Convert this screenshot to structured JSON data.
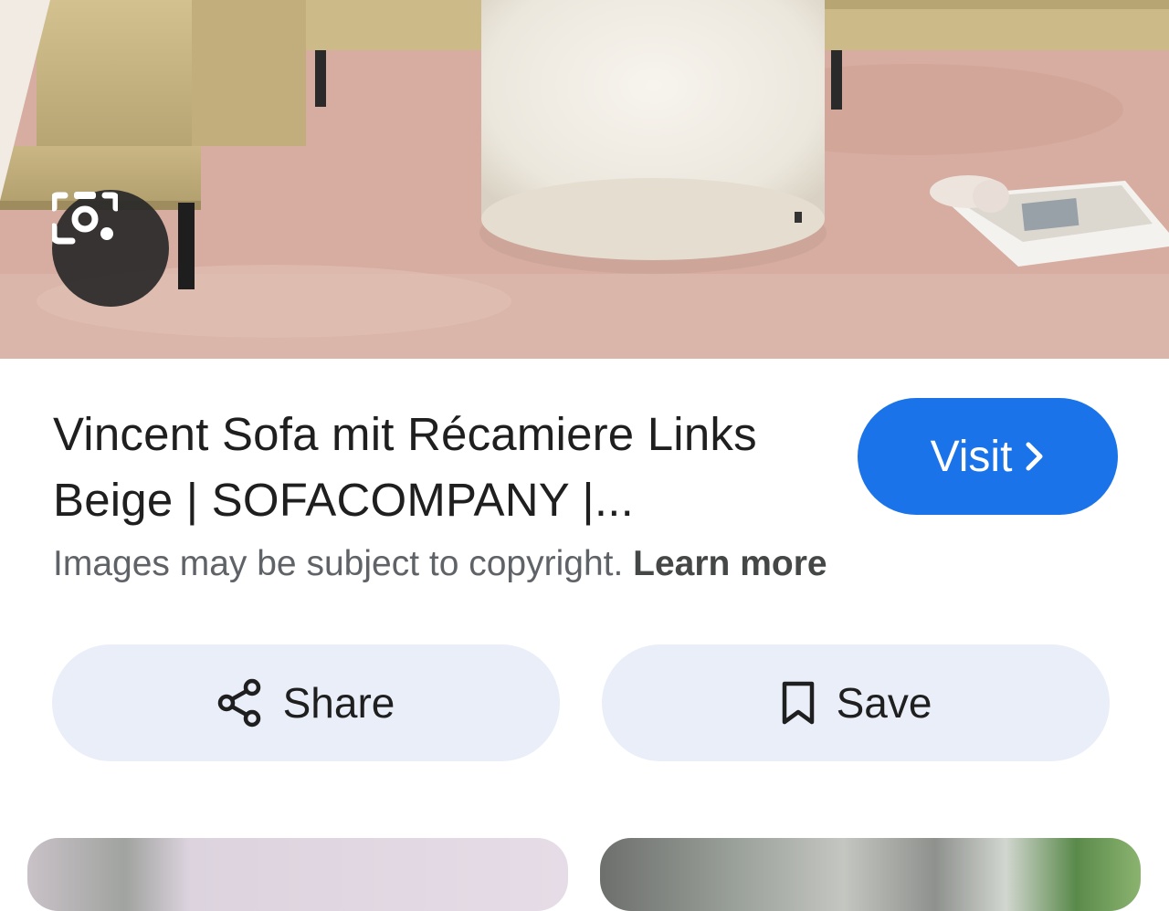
{
  "result": {
    "title": "Vincent Sofa mit Récamiere Links Beige | SOFACOMPANY |...",
    "visit_label": "Visit",
    "copyright_notice": "Images may be subject to copyright.",
    "learn_more_label": "Learn more"
  },
  "actions": {
    "share_label": "Share",
    "save_label": "Save"
  },
  "icons": {
    "lens": "google-lens-icon",
    "visit_chevron": "chevron-right-icon",
    "share": "share-icon",
    "save": "bookmark-icon"
  },
  "colors": {
    "accent": "#1a73e8",
    "action_background": "#e9eef9",
    "text_primary": "#1f1f1f",
    "text_secondary": "#5f6368"
  }
}
